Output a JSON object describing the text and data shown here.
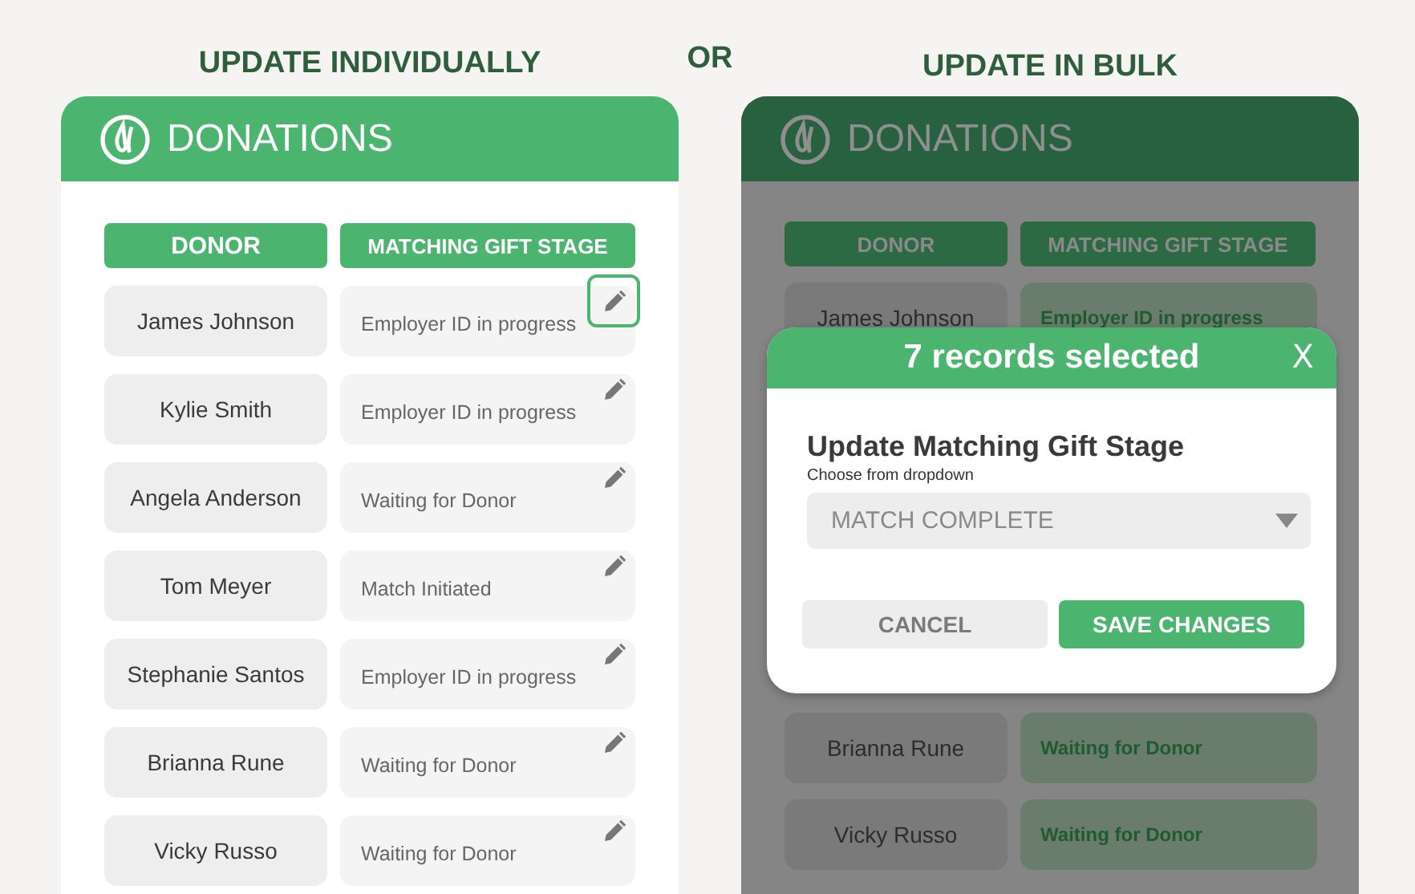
{
  "left": {
    "heading": "UPDATE INDIVIDUALLY",
    "panel_title": "DONATIONS",
    "columns": [
      "DONOR",
      "MATCHING GIFT STAGE"
    ],
    "rows": [
      {
        "donor": "James Johnson",
        "stage": "Employer ID in progress",
        "edit_focused": true
      },
      {
        "donor": "Kylie Smith",
        "stage": "Employer ID in progress",
        "edit_focused": false
      },
      {
        "donor": "Angela Anderson",
        "stage": "Waiting for Donor",
        "edit_focused": false
      },
      {
        "donor": "Tom Meyer",
        "stage": "Match Initiated",
        "edit_focused": false
      },
      {
        "donor": "Stephanie Santos",
        "stage": "Employer ID in progress",
        "edit_focused": false
      },
      {
        "donor": "Brianna Rune",
        "stage": "Waiting for Donor",
        "edit_focused": false
      },
      {
        "donor": "Vicky Russo",
        "stage": "Waiting for Donor",
        "edit_focused": false
      }
    ]
  },
  "separator": "OR",
  "right": {
    "heading": "UPDATE IN BULK",
    "panel_title": "DONATIONS",
    "columns": [
      "DONOR",
      "MATCHING GIFT STAGE"
    ],
    "rows_top": [
      {
        "donor": "James Johnson",
        "stage": "Employer ID in progress",
        "selected": true
      }
    ],
    "rows_bottom": [
      {
        "donor": "Brianna Rune",
        "stage": "Waiting for Donor",
        "selected": true
      },
      {
        "donor": "Vicky Russo",
        "stage": "Waiting for Donor",
        "selected": true
      }
    ],
    "dialog": {
      "title": "7 records selected",
      "close": "X",
      "label": "Update Matching Gift Stage",
      "hint": "Choose from dropdown",
      "dropdown_value": "MATCH COMPLETE",
      "buttons": [
        {
          "label": "CANCEL",
          "kind": "secondary"
        },
        {
          "label": "SAVE CHANGES",
          "kind": "primary"
        }
      ]
    }
  }
}
